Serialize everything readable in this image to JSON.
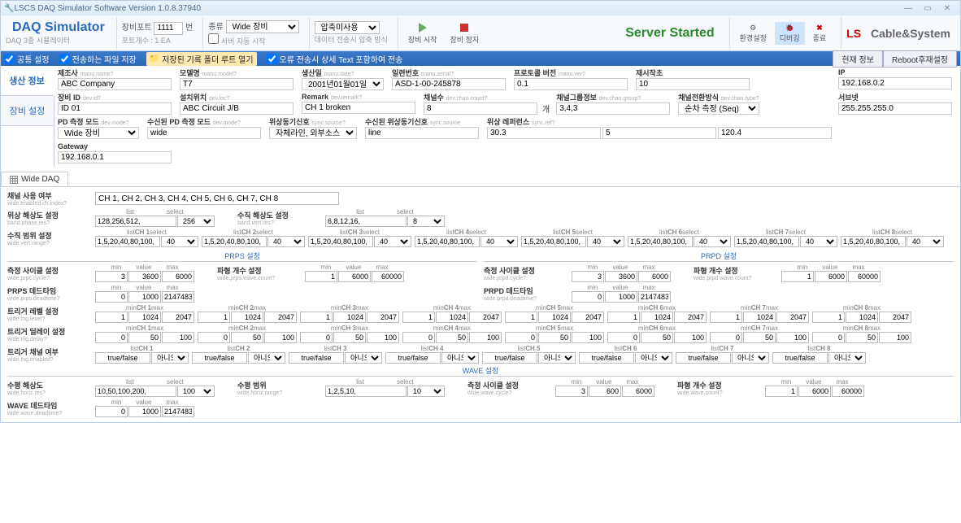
{
  "titlebar": "LSCS DAQ Simulator Software Version 1.0.8.37940",
  "app": {
    "title": "DAQ Simulator",
    "subtitle": "DAQ 3종 시뮬레이터"
  },
  "ribbon": {
    "port_label": "장비포트",
    "port_value": "1111",
    "port_suffix": "번",
    "type_label": "종류",
    "type_value": "Wide 장비",
    "enc_label": "압축미사용",
    "sub1": "포트개수 : 1 EA",
    "sub2": "서버 자동 시작",
    "sub3": "데이터 전송시 압축 방식",
    "start": "장비 시작",
    "stop": "장비 정지",
    "server_status": "Server Started",
    "env": "환경설정",
    "debug": "디버깅",
    "exit": "종료",
    "logo": "Cable&System"
  },
  "tb2": {
    "common": "공통 설정",
    "send_save": "전송하는 파일 저장",
    "open_root": "저장된 기록 폴더 루트 열기",
    "err_text": "오류 전송시 상세 Text 포함하여 전송",
    "cur_info": "현재 정보",
    "reboot": "Reboot후재설정"
  },
  "side": {
    "tab1": "생산 정보",
    "tab2": "장비 설정"
  },
  "info": {
    "manu": {
      "l": "제조사",
      "s": "manu.name?",
      "v": "ABC Company"
    },
    "model": {
      "l": "모델명",
      "s": "manu.model?",
      "v": "T7"
    },
    "manudate": {
      "l": "생산일",
      "s": "manu.date?",
      "v": "2001년01월01일"
    },
    "serial": {
      "l": "일련번호",
      "s": "manu.serial?",
      "v": "ASD-1-00-245878"
    },
    "proto": {
      "l": "프로토콜 버전",
      "s": "manu.ver?",
      "v": "0.1"
    },
    "restart": {
      "l": "재시작초",
      "s": "",
      "v": "10"
    },
    "ip": {
      "l": "IP",
      "v": "192.168.0.2"
    },
    "devid": {
      "l": "장비 ID",
      "s": "dev.id?",
      "v": "ID 01"
    },
    "loc": {
      "l": "설치위치",
      "s": "dev.loc?",
      "v": "ABC Circuit J/B"
    },
    "remark": {
      "l": "Remark",
      "s": "dev.remark?",
      "v": "CH 1 broken"
    },
    "chcnt": {
      "l": "채널수",
      "s": "dev.chan.count?",
      "v": "8",
      "suf": "개"
    },
    "chgrp": {
      "l": "채널그룹정보",
      "s": "dev.chan.group?",
      "v": "3,4,3"
    },
    "chsw": {
      "l": "채널전환방식",
      "s": "dev.chan.type?",
      "v": "순차 측정 (Seq)"
    },
    "subnet": {
      "l": "서브넷",
      "v": "255.255.255.0"
    },
    "pdmode": {
      "l": "PD 측정 모드",
      "s": "dev.mode?",
      "v": "Wide 장비"
    },
    "pdmode2": {
      "l": "수신된 PD 측정 모드",
      "s": "dev.mode?",
      "v": "wide"
    },
    "sync": {
      "l": "위상동기신호",
      "s": "sync.source?",
      "v": "자체라인, 외부소스"
    },
    "sync2": {
      "l": "수신된 위상동기신호",
      "s": "sync.source",
      "v": "line"
    },
    "phref": {
      "l": "위상 레퍼런스",
      "s": "sync.ref?",
      "v1": "30.3",
      "v2": "5",
      "v3": "120.4"
    },
    "gateway": {
      "l": "Gateway",
      "v": "192.168.0.1"
    }
  },
  "wide_tab": "Wide DAQ",
  "cfg": {
    "ch_use": {
      "l": "채널 사용 여부",
      "s": "wide.enabled.ch.index?",
      "v": "CH 1, CH 2, CH 3, CH 4, CH 5, CH 6, CH 7, CH 8"
    },
    "phase_res": {
      "l": "위상 해상도 설정",
      "s": "band.phase.res?",
      "list": "128,256,512,",
      "sel": "256"
    },
    "vert_res": {
      "l": "수직 해상도 설정",
      "s": "band.vert.res?",
      "list": "6,8,12,16,",
      "sel": "8"
    },
    "vert_range": {
      "l": "수직 범위 설정",
      "s": "wide.vert.range?",
      "list": "1,5,20,40,80,100,",
      "sel": "40"
    },
    "channels": [
      "CH 1",
      "CH 2",
      "CH 3",
      "CH 4",
      "CH 5",
      "CH 6",
      "CH 7",
      "CH 8"
    ],
    "prps_title": "PRPS 설정",
    "prpd_title": "PRPD 설정",
    "wave_title": "WAVE 설정",
    "cycle": {
      "l": "측정 사이클 설정",
      "s": "wide.prps.cycle?",
      "min": "3",
      "val": "3600",
      "max": "6000"
    },
    "wavec": {
      "l": "파형 개수 설정",
      "s": "wide.prps.wave.count?",
      "min": "1",
      "val": "6000",
      "max": "60000"
    },
    "dead": {
      "l": "PRPS 데드타임",
      "s": "wide.prps.deadtime?",
      "min": "0",
      "val": "1000",
      "max": "2147483"
    },
    "cycle2": {
      "l": "측정 사이클 설정",
      "s": "wide.prpd.cycle?",
      "min": "3",
      "val": "3600",
      "max": "6000"
    },
    "wavec2": {
      "l": "파형 개수 설정",
      "s": "wide.prpd.wave.count?",
      "min": "1",
      "val": "6000",
      "max": "60000"
    },
    "dead2": {
      "l": "PRPD 데드타임",
      "s": "wide.prpd.deadtime?",
      "min": "0",
      "val": "1000",
      "max": "2147483"
    },
    "trig_lvl": {
      "l": "트리거 레벨 설정",
      "s": "wide.trig.level?",
      "min": "1",
      "val": "1024",
      "max": "2047"
    },
    "trig_dly": {
      "l": "트리거 딜레이 설정",
      "s": "wide.trig.delay?",
      "min": "0",
      "val": "50",
      "max": "100"
    },
    "trig_en": {
      "l": "트리거 채널 여부",
      "s": "wide.trig.enabled?",
      "list": "true/false",
      "sel": "아니오"
    },
    "horz_res": {
      "l": "수평 해상도",
      "s": "wide.horiz.res?",
      "list": "10,50,100,200,",
      "sel": "100"
    },
    "horz_rng": {
      "l": "수평 범위",
      "s": "wide.horiz.range?",
      "list": "1,2,5,10,",
      "sel": "10"
    },
    "wcycle": {
      "l": "측정 사이클 설정",
      "s": "wide.wave.cycle?",
      "min": "3",
      "val": "600",
      "max": "6000"
    },
    "wcount": {
      "l": "파형 개수 설정",
      "s": "wide.wave.count?",
      "min": "1",
      "val": "6000",
      "max": "60000"
    },
    "wdead": {
      "l": "WAVE 데드타임",
      "s": "wide.wave.deadtime?",
      "min": "0",
      "val": "1000",
      "max": "2147483"
    },
    "hdr_list": "list",
    "hdr_sel": "select",
    "hdr_min": "min",
    "hdr_val": "value",
    "hdr_max": "max"
  }
}
